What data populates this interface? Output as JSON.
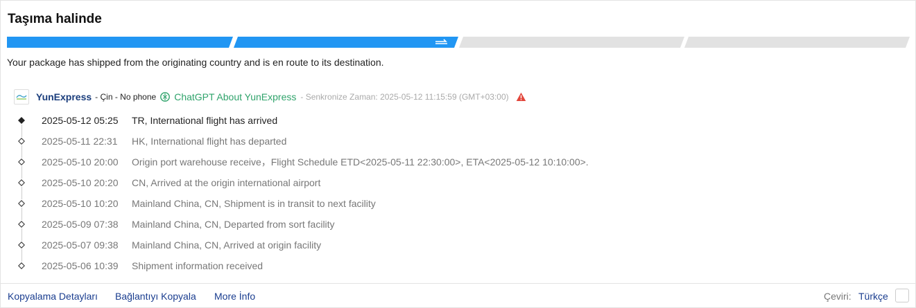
{
  "title": "Taşıma halinde",
  "progress": {
    "steps_total": 4,
    "steps_completed": 2,
    "active_color": "#2196f3",
    "inactive_color": "#e2e2e2"
  },
  "status_message": "Your package has shipped from the originating country and is en route to its destination.",
  "carrier": {
    "name": "YunExpress",
    "meta": "- Çin - No phone",
    "gpt_link": "ChatGPT About YunExpress",
    "sync_text": "- Senkronize Zaman: 2025-05-12 11:15:59 (GMT+03:00)",
    "logo_icon": "yunexpress-logo",
    "warning_icon": "warning-triangle-icon"
  },
  "events": [
    {
      "date": "2025-05-12 05:25",
      "desc": "TR, International flight has arrived"
    },
    {
      "date": "2025-05-11 22:31",
      "desc": "HK, International flight has departed"
    },
    {
      "date": "2025-05-10 20:00",
      "desc": "Origin port warehouse receive，Flight Schedule ETD<2025-05-11 22:30:00>, ETA<2025-05-12 10:10:00>."
    },
    {
      "date": "2025-05-10 20:20",
      "desc": "CN, Arrived at the origin international airport"
    },
    {
      "date": "2025-05-10 10:20",
      "desc": "Mainland China, CN, Shipment is in transit to next facility"
    },
    {
      "date": "2025-05-09 07:38",
      "desc": "Mainland China, CN, Departed from sort facility"
    },
    {
      "date": "2025-05-07 09:38",
      "desc": "Mainland China, CN, Arrived at origin facility"
    },
    {
      "date": "2025-05-06 10:39",
      "desc": "Shipment information received"
    }
  ],
  "footer": {
    "copy_details": "Kopyalama Detayları",
    "copy_link": "Bağlantıyı Kopyala",
    "more_info": "More İnfo",
    "translate_label": "Çeviri:",
    "translate_value": "Türkçe"
  }
}
